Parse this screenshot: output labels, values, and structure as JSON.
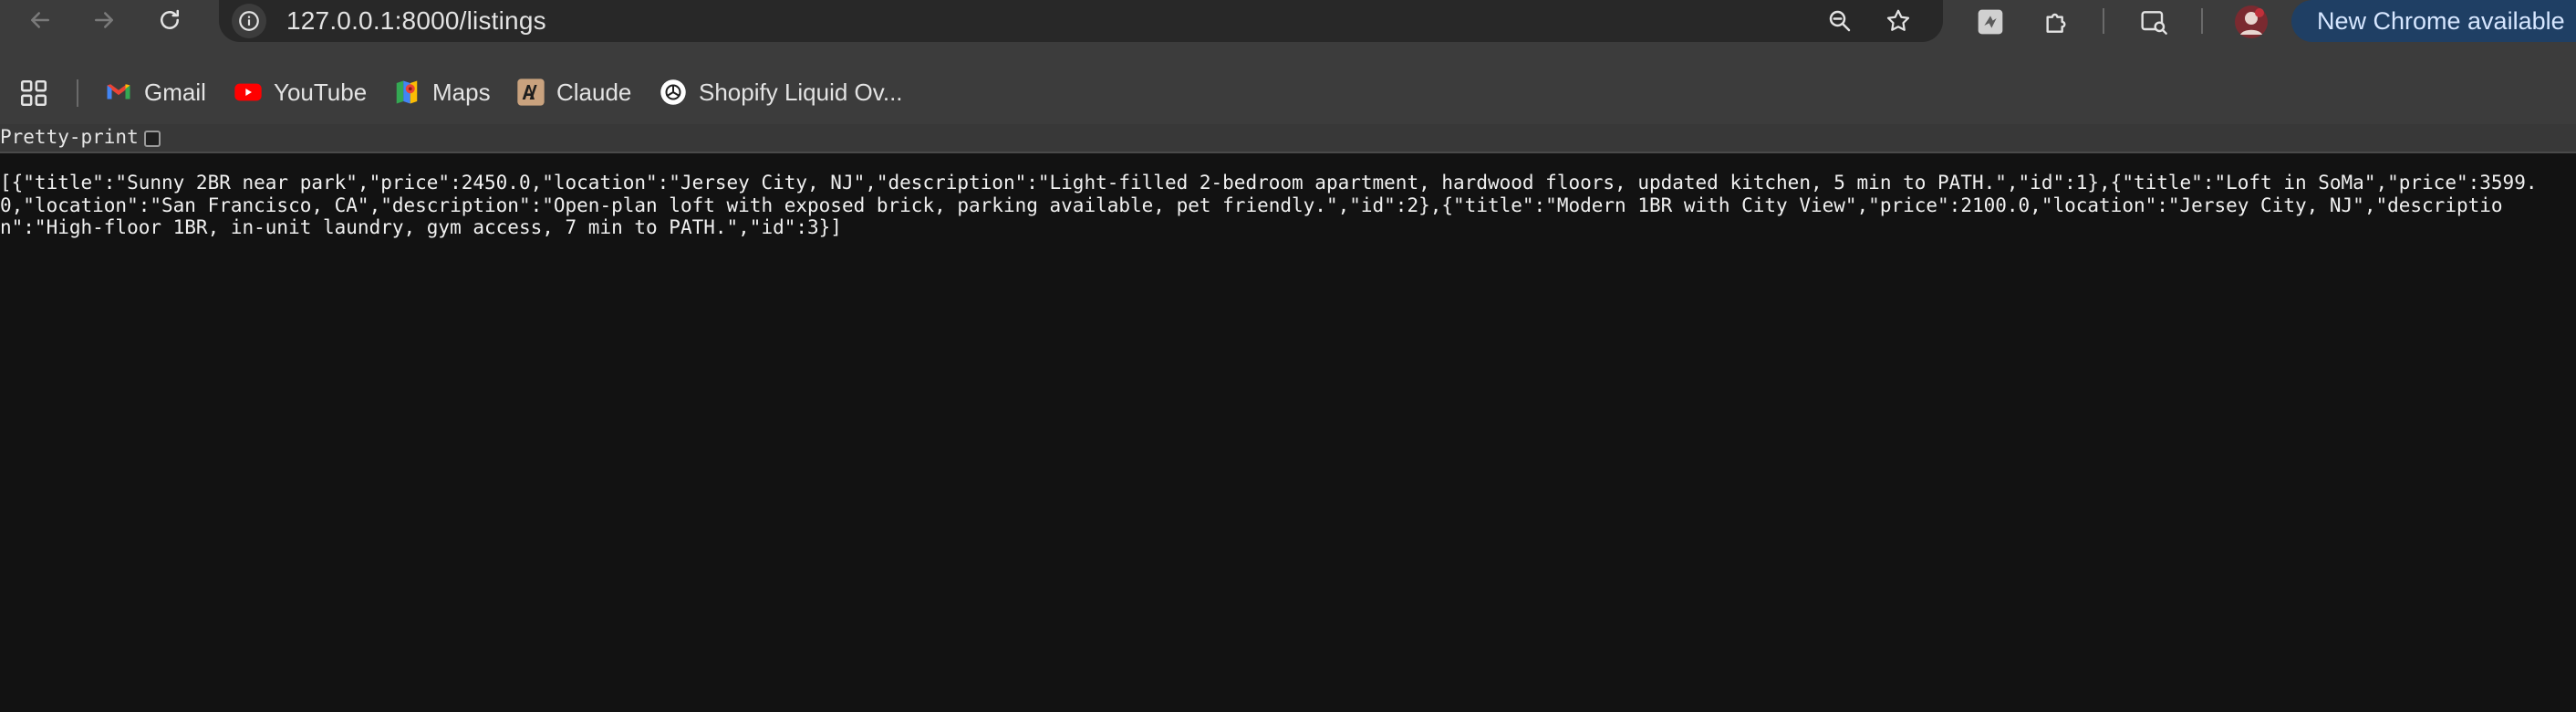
{
  "browser": {
    "url": "127.0.0.1:8000/listings",
    "new_chrome_label": "New Chrome available"
  },
  "bookmarks": [
    {
      "label": "Gmail",
      "icon": "gmail-icon"
    },
    {
      "label": "YouTube",
      "icon": "youtube-icon"
    },
    {
      "label": "Maps",
      "icon": "maps-icon"
    },
    {
      "label": "Claude",
      "icon": "claude-icon"
    },
    {
      "label": "Shopify Liquid Ov...",
      "icon": "openai-icon"
    }
  ],
  "page": {
    "pretty_print_label": "Pretty-print",
    "pretty_print_checked": false,
    "json_text": "[{\"title\":\"Sunny 2BR near park\",\"price\":2450.0,\"location\":\"Jersey City, NJ\",\"description\":\"Light-filled 2-bedroom apartment, hardwood floors, updated kitchen, 5 min to PATH.\",\"id\":1},{\"title\":\"Loft in SoMa\",\"price\":3599.0,\"location\":\"San Francisco, CA\",\"description\":\"Open-plan loft with exposed brick, parking available, pet friendly.\",\"id\":2},{\"title\":\"Modern 1BR with City View\",\"price\":2100.0,\"location\":\"Jersey City, NJ\",\"description\":\"High-floor 1BR, in-unit laundry, gym access, 7 min to PATH.\",\"id\":3}]"
  },
  "colors": {
    "toolbar_bg": "#3c3c3c",
    "omnibox_bg": "#282828",
    "page_bg": "#121212",
    "update_button_bg": "#1f3f64"
  }
}
